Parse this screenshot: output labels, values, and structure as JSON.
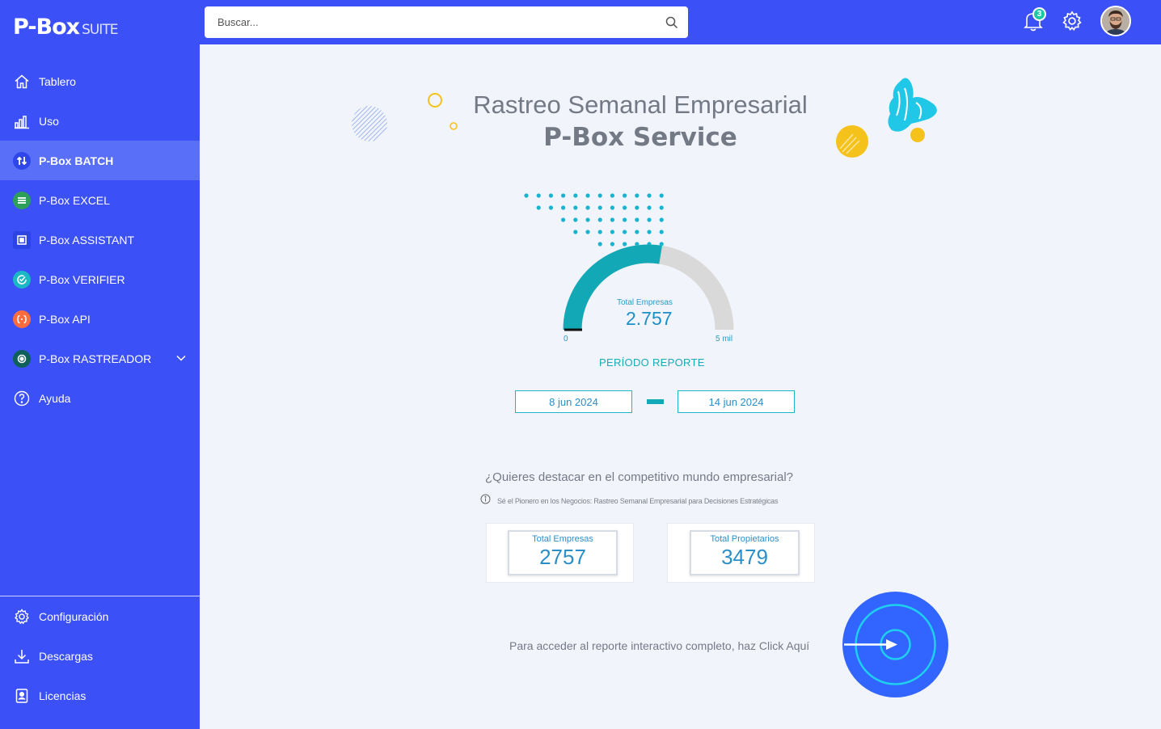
{
  "app": {
    "logo_main": "P-Box",
    "logo_sub": "SUITE"
  },
  "sidebar": {
    "items": [
      {
        "label": "Tablero",
        "icon": "home-icon"
      },
      {
        "label": "Uso",
        "icon": "bar-chart-icon"
      },
      {
        "label": "P-Box BATCH",
        "icon": "swap-arrows-icon",
        "active": true
      },
      {
        "label": "P-Box EXCEL",
        "icon": "list-lines-icon"
      },
      {
        "label": "P-Box ASSISTANT",
        "icon": "square-frame-icon"
      },
      {
        "label": "P-Box VERIFIER",
        "icon": "check-circle-icon"
      },
      {
        "label": "P-Box API",
        "icon": "code-brackets-icon"
      },
      {
        "label": "P-Box RASTREADOR",
        "icon": "target-icon"
      },
      {
        "label": "Ayuda",
        "icon": "help-icon"
      }
    ],
    "bottom_items": [
      {
        "label": "Configuración",
        "icon": "gear-icon"
      },
      {
        "label": "Descargas",
        "icon": "download-icon"
      },
      {
        "label": "Licencias",
        "icon": "badge-card-icon"
      }
    ],
    "colors": {
      "background": "#3b50f6",
      "active": "#5a6ff7",
      "excel_icon": "#2e9e5b",
      "verifier_icon": "#1ab7c4",
      "api_icon": "#ff6b3d",
      "rastreador_icon": "#0f5f5a"
    }
  },
  "topbar": {
    "search_placeholder": "Buscar...",
    "notifications_count": "3"
  },
  "report": {
    "title_line1": "Rastreo Semanal Empresarial",
    "title_line2": "P-Box Service",
    "gauge": {
      "label": "Total Empresas",
      "value_display": "2.757",
      "value": 2757,
      "min": 0,
      "max": 5000,
      "min_label": "0",
      "max_label": "5 mil",
      "fill_color": "#13a8b6",
      "track_color": "#d9d9d9"
    },
    "period_label": "PERÍODO REPORTE",
    "date_start": "8 jun 2024",
    "date_end": "14 jun 2024",
    "question": "¿Quieres destacar en el competitivo mundo empresarial?",
    "subtitle": "Sé el Pionero en los Negocios: Rastreo Semanal Empresarial para Decisiones Estratégicas",
    "cards": [
      {
        "label": "Total Empresas",
        "value": "2757"
      },
      {
        "label": "Total Propietarios",
        "value": "3479"
      }
    ],
    "access_text": "Para acceder al reporte interactivo completo, haz Click Aquí"
  }
}
